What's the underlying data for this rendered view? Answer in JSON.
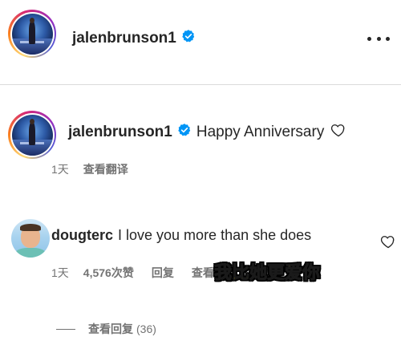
{
  "post": {
    "author": "jalenbrunson1",
    "verified": true
  },
  "caption": {
    "author": "jalenbrunson1",
    "text": "Happy Anniversary",
    "time": "1天",
    "translate_label": "查看翻译"
  },
  "comment": {
    "author": "dougterc",
    "text": "I love you more than she does",
    "time": "1天",
    "likes_label": "4,576次赞",
    "reply_label": "回复",
    "translate_label": "查看翻译",
    "view_replies_label": "查看回复",
    "replies_count": "(36)"
  },
  "annotation": {
    "text": "我比她更爱你",
    "color": "#f7e600"
  },
  "colors": {
    "verified_badge": "#0095f6",
    "text_primary": "#262626",
    "text_secondary": "#737373",
    "divider": "#dbdbdb"
  },
  "icons": [
    "more-options-icon",
    "verified-icon",
    "heart-icon"
  ]
}
